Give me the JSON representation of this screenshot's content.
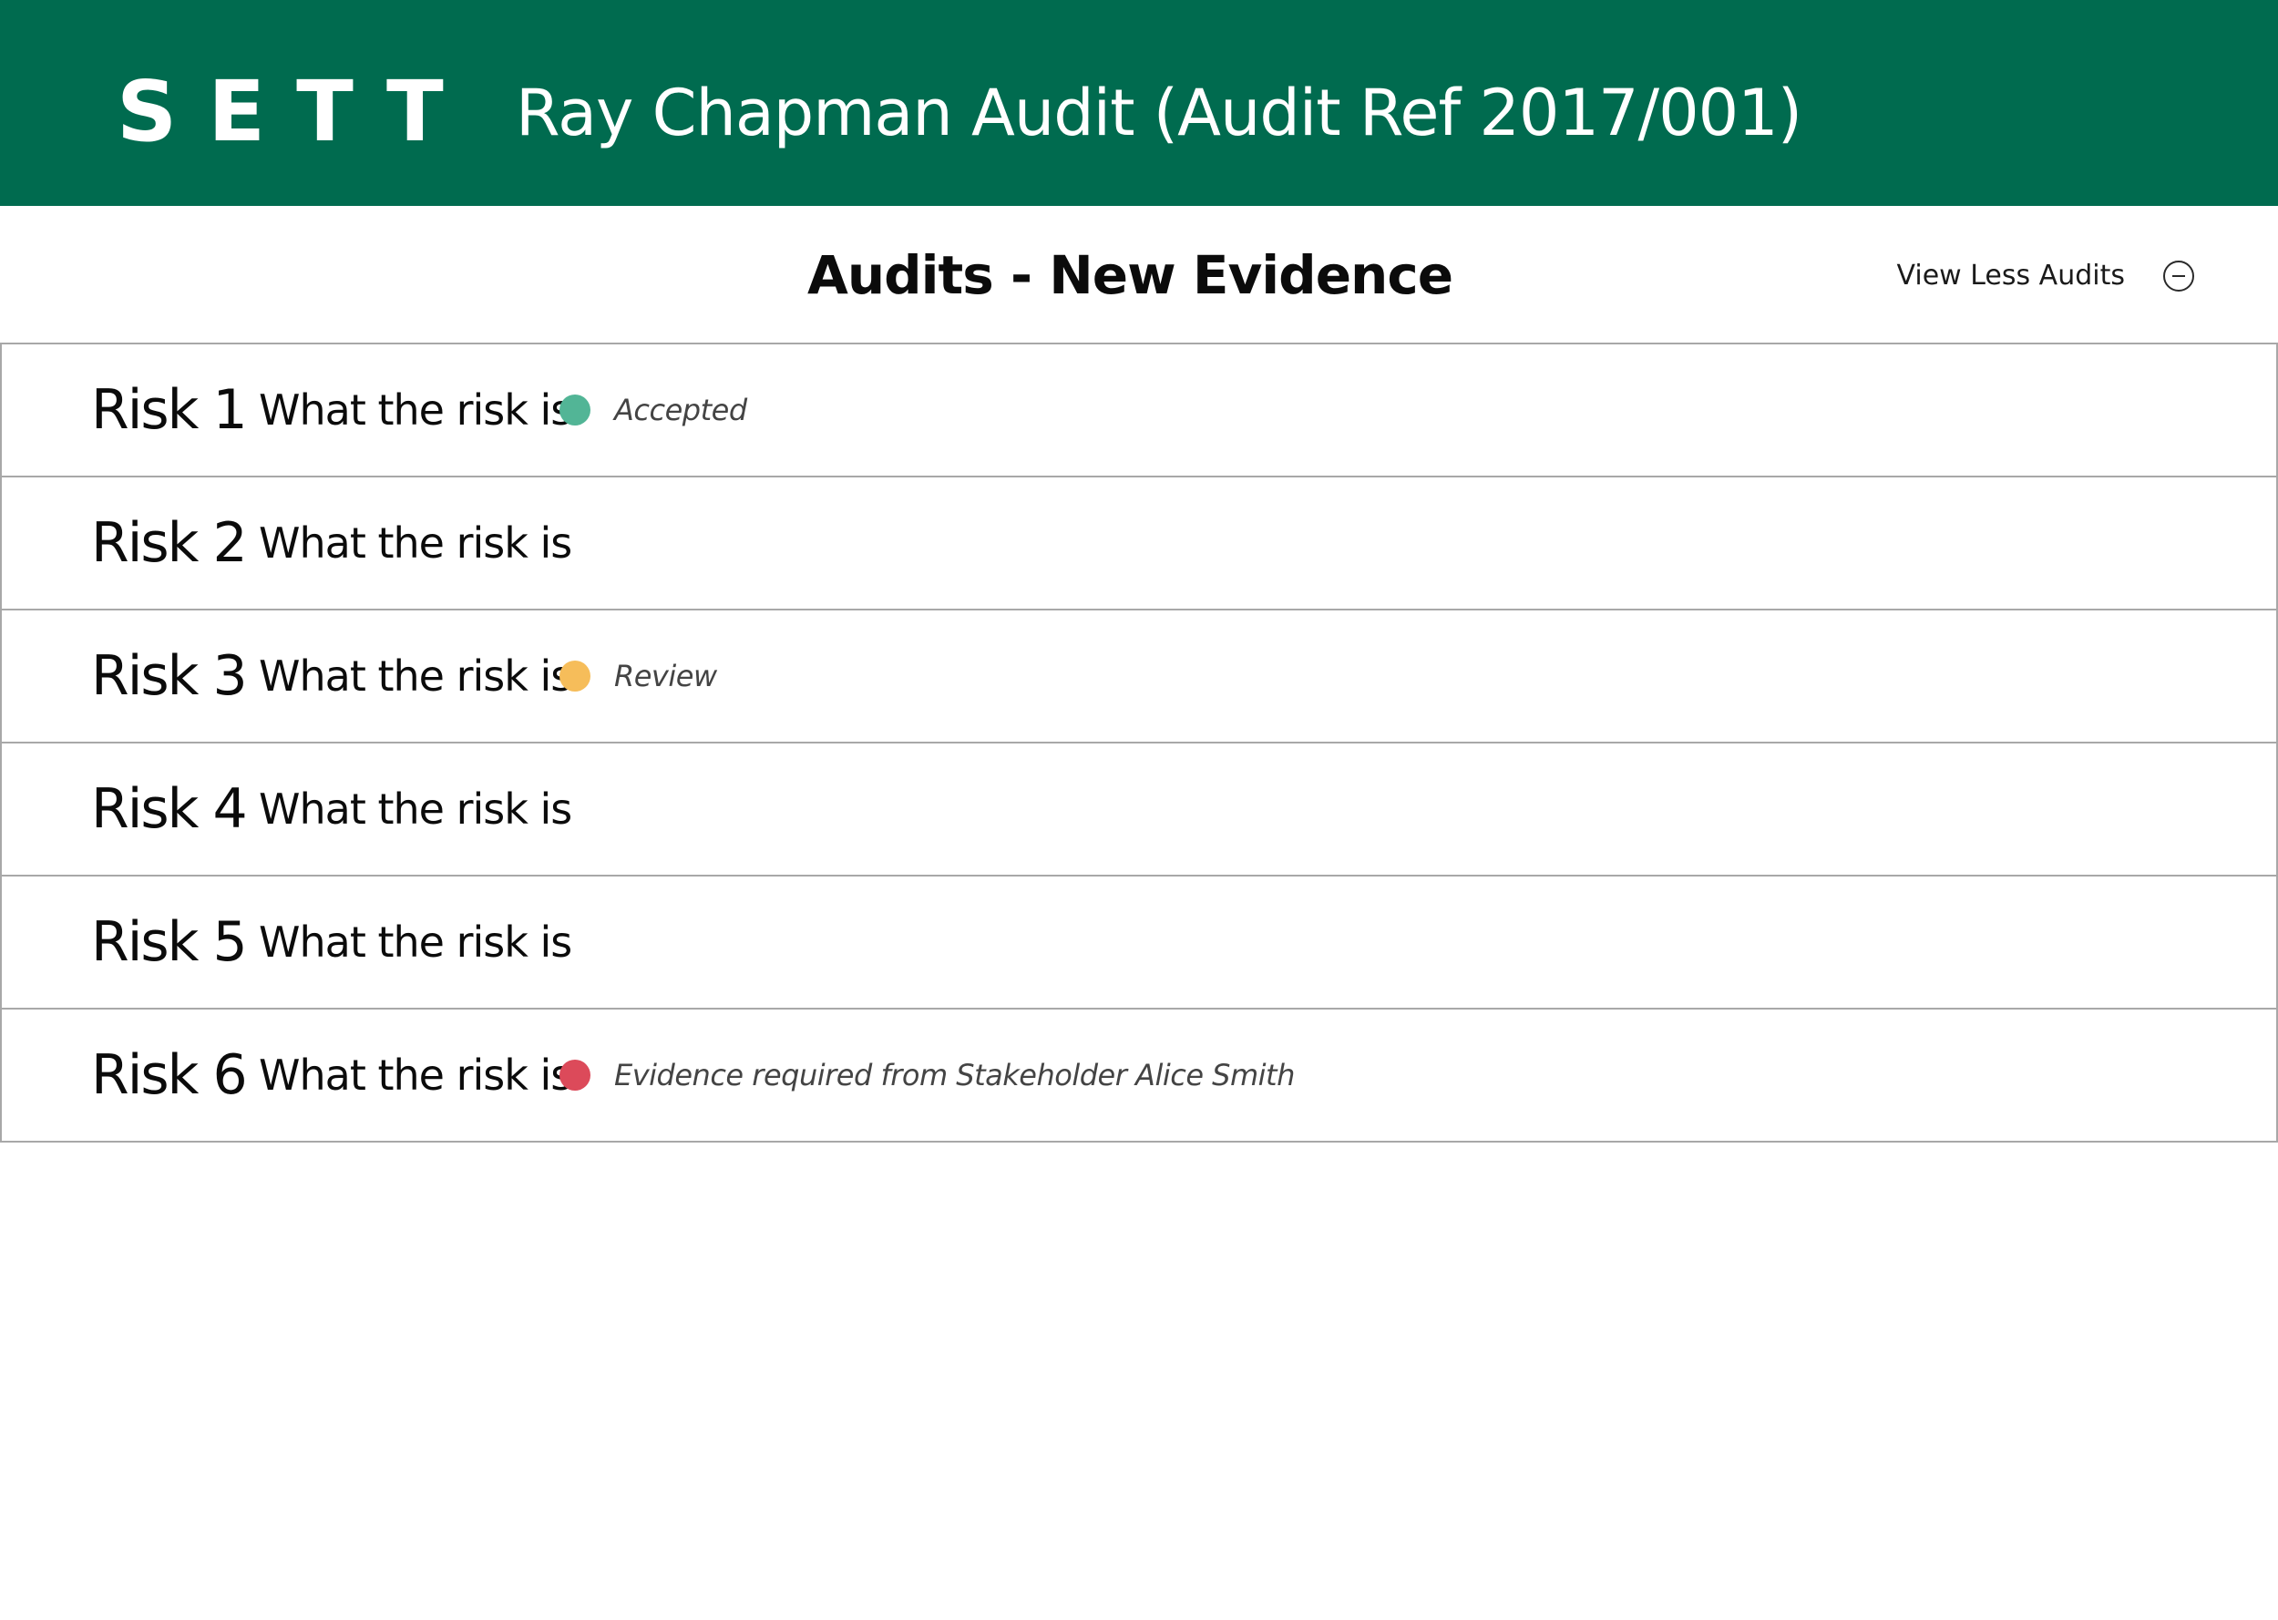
{
  "header": {
    "logo": "SETT",
    "title": "Ray Chapman Audit (Audit Ref 2017/001)",
    "background_color": "#006b4f"
  },
  "subheader": {
    "title": "Audits - New Evidence",
    "view_toggle_label": "View Less Audits",
    "view_toggle_icon": "minus-circle-icon"
  },
  "risks": [
    {
      "id": "Risk 1",
      "description": "What the risk is",
      "status": "Accepted",
      "status_color": "#52b596"
    },
    {
      "id": "Risk 2",
      "description": "What the risk is",
      "status": "",
      "status_color": ""
    },
    {
      "id": "Risk 3",
      "description": "What the risk is",
      "status": "Review",
      "status_color": "#f6bd5a"
    },
    {
      "id": "Risk 4",
      "description": "What the risk is",
      "status": "",
      "status_color": ""
    },
    {
      "id": "Risk 5",
      "description": "What the risk is",
      "status": "",
      "status_color": ""
    },
    {
      "id": "Risk 6",
      "description": "What the risk is",
      "status": "Evidence required from Stakeholder Alice Smith",
      "status_color": "#dc4a5a"
    }
  ]
}
